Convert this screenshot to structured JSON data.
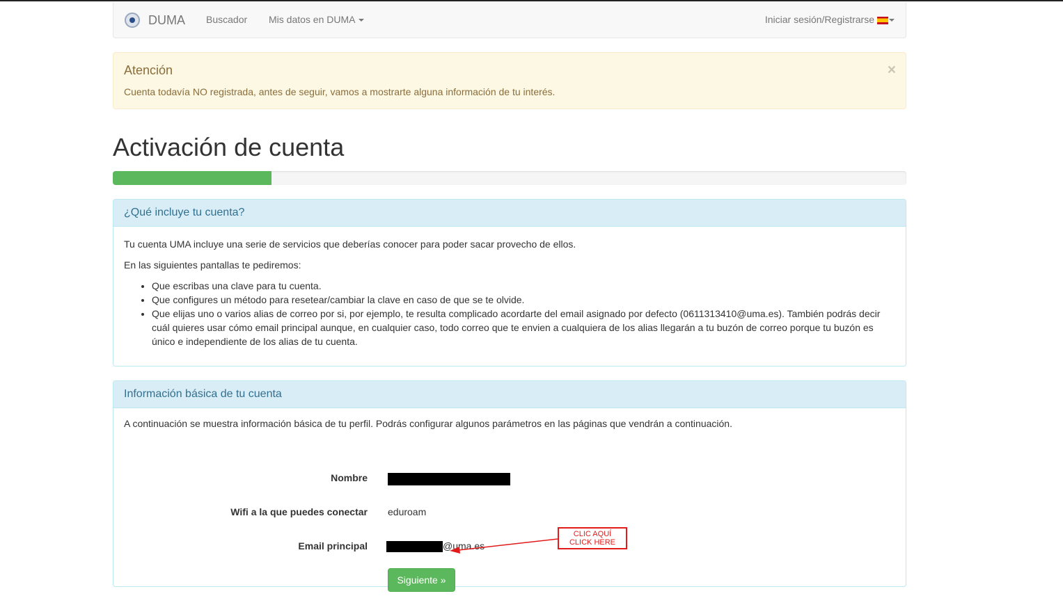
{
  "navbar": {
    "brand": "DUMA",
    "links": [
      "Buscador",
      "Mis datos en DUMA"
    ],
    "login": "Iniciar sesión/Registrarse"
  },
  "alert": {
    "title": "Atención",
    "text": "Cuenta todavía NO registrada, antes de seguir, vamos a mostrarte alguna información de tu interés.",
    "close": "×"
  },
  "page": {
    "title": "Activación de cuenta",
    "progress": 0.2
  },
  "panel_services": {
    "heading": "¿Qué incluye tu cuenta?",
    "intro": "Tu cuenta UMA incluye una serie de servicios que deberías conocer para poder sacar provecho de ellos.",
    "lead": "En las siguientes pantallas te pediremos:",
    "items": [
      "Que escribas una clave para tu cuenta.",
      "Que configures un método para resetear/cambiar la clave en caso de que se te olvide.",
      "Que elijas uno o varios alias de correo por si, por ejemplo, te resulta complicado acordarte del email asignado por defecto (0611313410@uma.es). También podrás decir cuál quieres usar cómo email principal aunque, en cualquier caso, todo correo que te envien a cualquiera de los alias llegarán a tu buzón de correo porque tu buzón es único e independiente de los alias de tu cuenta."
    ]
  },
  "panel_info": {
    "heading": "Información básica de tu cuenta",
    "intro": "A continuación se muestra información básica de tu perfil. Podrás configurar algunos parámetros en las páginas que vendrán a continuación.",
    "name_label": "Nombre",
    "wifi_label": "Wifi a la que puedes conectar",
    "wifi_value": "eduroam",
    "email_label": "Email principal",
    "email_domain": "@uma.es",
    "next_button": "Siguiente »"
  },
  "annotation": {
    "line1": "CLIC AQUÍ",
    "line2": "CLICK HERE",
    "color": "#e21a1a"
  },
  "icons": {
    "logo": "university-seal-icon",
    "language": "spain-flag-icon",
    "dropdown": "caret-down-icon"
  }
}
